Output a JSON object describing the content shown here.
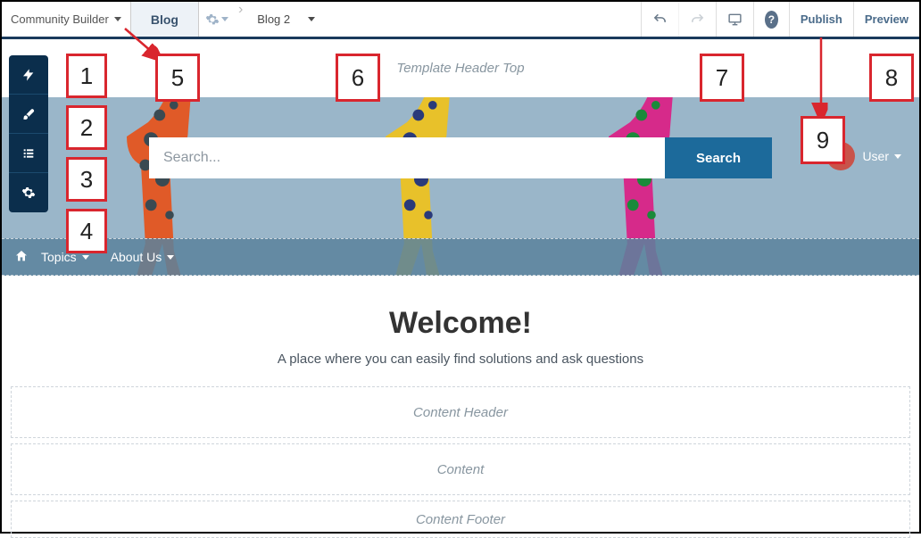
{
  "topbar": {
    "app_name": "Community Builder",
    "page_label": "Blog",
    "subpage": "Blog 2",
    "publish": "Publish",
    "preview": "Preview"
  },
  "hero": {
    "header_top_slot": "Template Header Top",
    "search_placeholder": "Search...",
    "search_button": "Search",
    "user_label": "User"
  },
  "nav": {
    "topics": "Topics",
    "about": "About Us"
  },
  "welcome": {
    "title": "Welcome!",
    "subtitle": "A place where you can easily find solutions and ask questions"
  },
  "slots": {
    "content_header": "Content Header",
    "content": "Content",
    "content_footer": "Content Footer"
  },
  "callouts": [
    "1",
    "2",
    "3",
    "4",
    "5",
    "6",
    "7",
    "8",
    "9"
  ]
}
